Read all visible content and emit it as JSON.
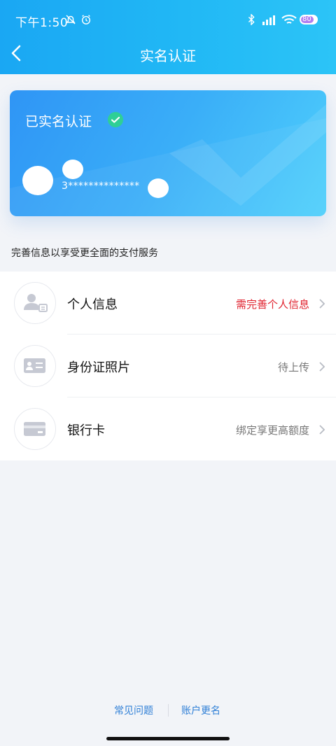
{
  "status_bar": {
    "time": "下午1:50",
    "battery": "80",
    "icons": [
      "do-not-disturb-icon",
      "alarm-icon",
      "bluetooth-icon",
      "signal-icon",
      "wifi-icon",
      "battery-icon"
    ]
  },
  "nav": {
    "title": "实名认证",
    "back_icon": "chevron-left-icon"
  },
  "card": {
    "status_label": "已实名认证",
    "verified_icon": "check-icon",
    "id_masked": "3**************",
    "colors": {
      "start": "#2f95f5",
      "end": "#4fd0fb",
      "check": "#2fcf96"
    }
  },
  "hint": "完善信息以享受更全面的支付服务",
  "list": {
    "items": [
      {
        "icon": "person-id-icon",
        "title": "个人信息",
        "value": "需完善个人信息",
        "value_color": "#e0232f"
      },
      {
        "icon": "id-card-icon",
        "title": "身份证照片",
        "value": "待上传",
        "value_color": "#777777"
      },
      {
        "icon": "bank-card-icon",
        "title": "银行卡",
        "value": "绑定享更高额度",
        "value_color": "#777777"
      }
    ]
  },
  "footer": {
    "faq": "常见问题",
    "rename": "账户更名",
    "link_color": "#2f7fd6"
  }
}
